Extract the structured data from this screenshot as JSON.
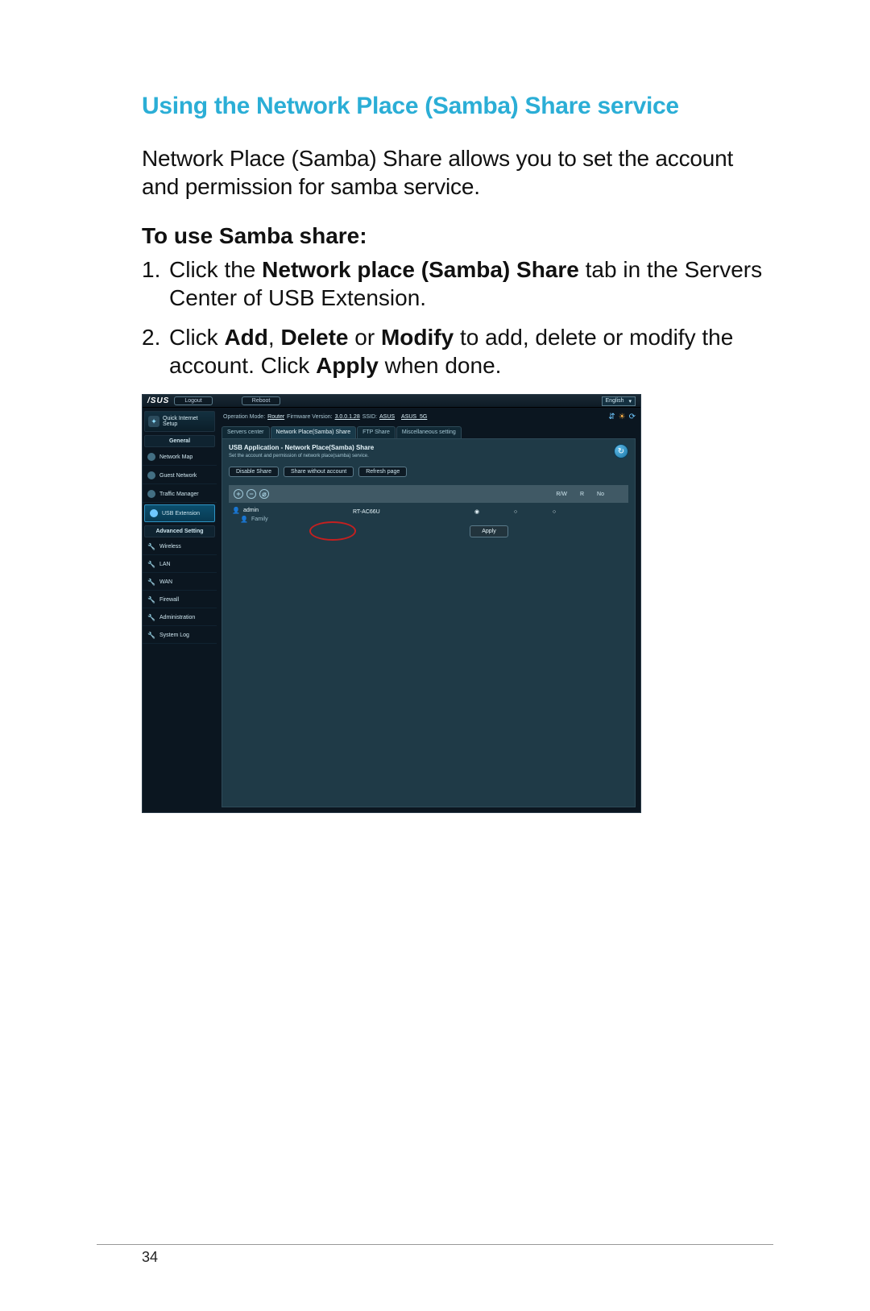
{
  "doc": {
    "title": "Using the Network Place (Samba) Share service",
    "intro": "Network Place (Samba) Share allows you to set the account and permission for samba service.",
    "subhead": "To use Samba share:",
    "step1_pre": "Click the ",
    "step1_bold": "Network place (Samba) Share",
    "step1_post": " tab in the Servers Center of USB Extension.",
    "step2_a": "Click ",
    "step2_b1": "Add",
    "step2_c": ", ",
    "step2_b2": "Delete",
    "step2_d": " or ",
    "step2_b3": "Modify",
    "step2_e": " to add, delete or modify the account. Click ",
    "step2_b4": "Apply",
    "step2_f": " when done.",
    "page_num": "34"
  },
  "ui": {
    "brand": "/SUS",
    "logout": "Logout",
    "reboot": "Reboot",
    "language": "English",
    "status_mode_label": "Operation Mode: ",
    "status_mode_value": "Router",
    "status_fw_label": "  Firmware Version: ",
    "status_fw_value": "3.0.0.1.28",
    "status_ssid_label": "  SSID: ",
    "status_ssid1": "ASUS",
    "status_ssid2": "ASUS_5G",
    "tabs": {
      "t0": "Servers center",
      "t1": "Network Place(Samba) Share",
      "t2": "FTP Share",
      "t3": "Miscellaneous setting"
    },
    "panel_title": "USB Application - Network Place(Samba) Share",
    "panel_sub": "Set the account and permission of network place(samba) service.",
    "btn_disable": "Disable Share",
    "btn_share_noacct": "Share without account",
    "btn_refresh": "Refresh page",
    "cols": {
      "rw": "R/W",
      "r": "R",
      "no": "No"
    },
    "tree_admin": "admin",
    "tree_family": "Family",
    "device": "RT-AC66U",
    "apply": "Apply",
    "sidebar": {
      "quick": "Quick Internet\nSetup",
      "general": "General",
      "items_general": [
        "Network Map",
        "Guest Network",
        "Traffic Manager",
        "USB Extension"
      ],
      "advanced": "Advanced Setting",
      "items_adv": [
        "Wireless",
        "LAN",
        "WAN",
        "Firewall",
        "Administration",
        "System Log"
      ]
    }
  }
}
